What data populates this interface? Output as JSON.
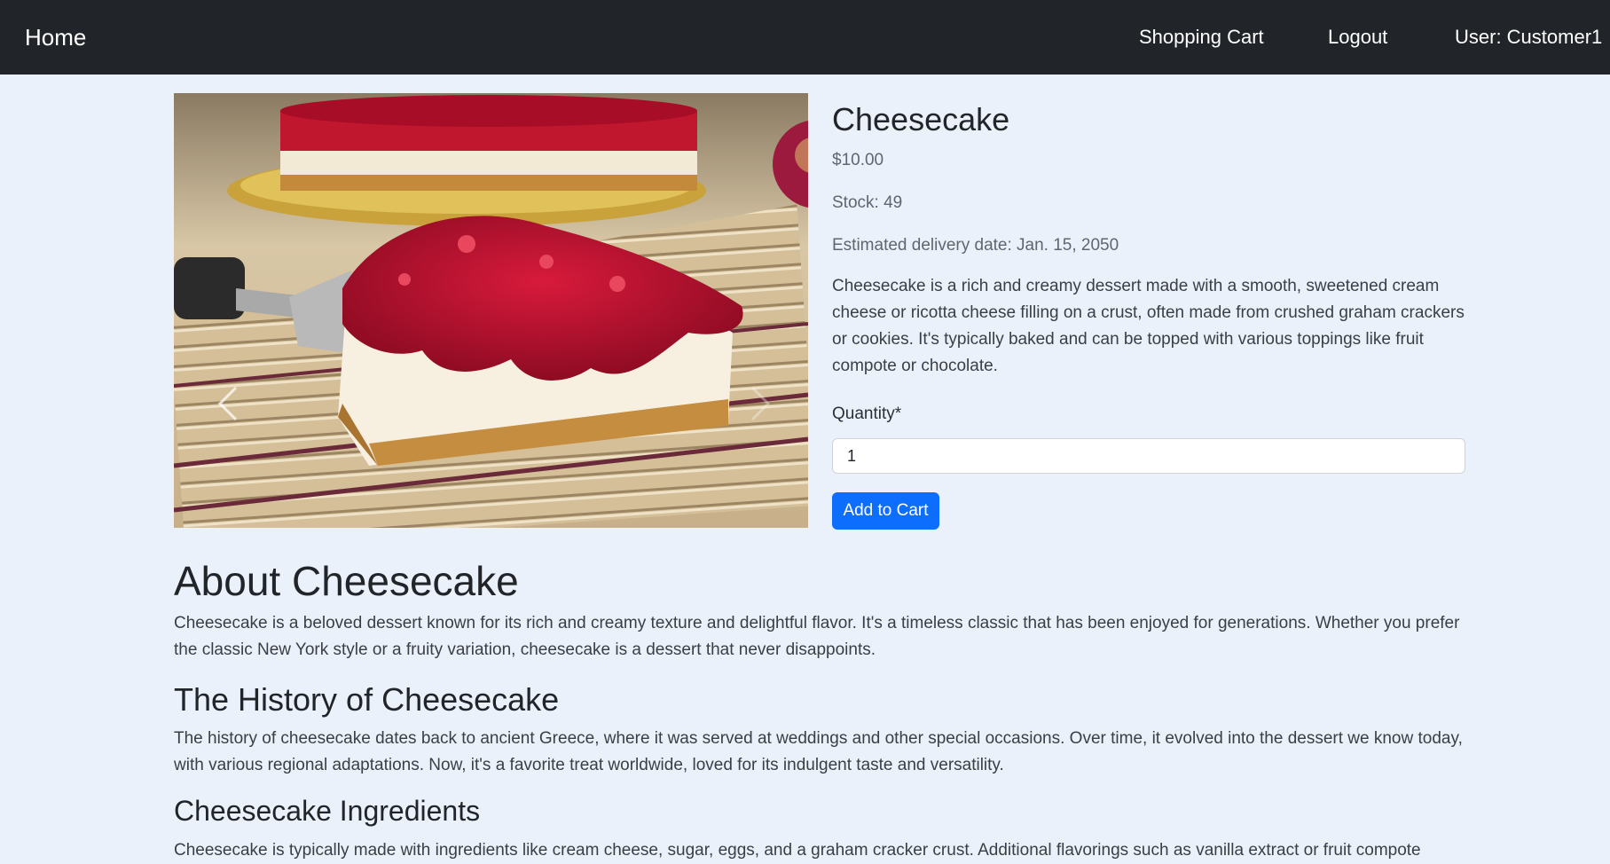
{
  "nav": {
    "brand": "Home",
    "cart": "Shopping Cart",
    "logout": "Logout",
    "user": "User: Customer1"
  },
  "product": {
    "name": "Cheesecake",
    "price": "$10.00",
    "stock": "Stock: 49",
    "delivery": "Estimated delivery date: Jan. 15, 2050",
    "description": "Cheesecake is a rich and creamy dessert made with a smooth, sweetened cream cheese or ricotta cheese filling on a crust, often made from crushed graham crackers or cookies. It's typically baked and can be topped with various toppings like fruit compote or chocolate.",
    "quantity_label": "Quantity*",
    "quantity_value": "1",
    "add_to_cart": "Add to Cart",
    "image_icon": "cheesecake-photo"
  },
  "about": {
    "title": "About Cheesecake",
    "text": "Cheesecake is a beloved dessert known for its rich and creamy texture and delightful flavor. It's a timeless classic that has been enjoyed for generations. Whether you prefer the classic New York style or a fruity variation, cheesecake is a dessert that never disappoints."
  },
  "history": {
    "title": "The History of Cheesecake",
    "text": "The history of cheesecake dates back to ancient Greece, where it was served at weddings and other special occasions. Over time, it evolved into the dessert we know today, with various regional adaptations. Now, it's a favorite treat worldwide, loved for its indulgent taste and versatility."
  },
  "ingredients": {
    "title": "Cheesecake Ingredients",
    "text": "Cheesecake is typically made with ingredients like cream cheese, sugar, eggs, and a graham cracker crust. Additional flavorings such as vanilla extract or fruit compote"
  },
  "colors": {
    "navbar": "#212529",
    "background": "#ebf1fa",
    "primary": "#0d6efd"
  }
}
